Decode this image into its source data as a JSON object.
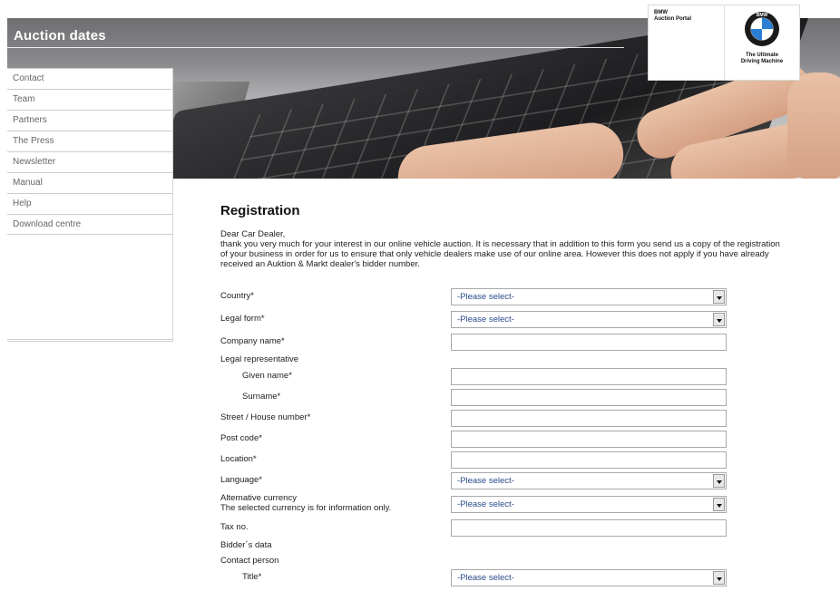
{
  "header": {
    "title": "Auction dates",
    "brand_portal_line1": "BMW",
    "brand_portal_line2": "Auction Portal",
    "slogan_line1": "The Ultimate",
    "slogan_line2": "Driving Machine",
    "logo_icon": "bmw-roundel-icon",
    "logo_letters": "BMW"
  },
  "sidebar": {
    "items": [
      {
        "label": "Contact"
      },
      {
        "label": "Team"
      },
      {
        "label": "Partners"
      },
      {
        "label": "The Press"
      },
      {
        "label": "Newsletter"
      },
      {
        "label": "Manual"
      },
      {
        "label": "Help"
      },
      {
        "label": "Download centre"
      }
    ]
  },
  "main": {
    "heading": "Registration",
    "greeting": "Dear Car Dealer,",
    "intro_line1": "thank you very much for your interest in our online vehicle auction. It is necessary that in addition to this form you send us a copy of the registration",
    "intro_line2": "of your business in order for us to ensure that only vehicle dealers make use of our online area. However this does not apply if you have already",
    "intro_line3": "received an Auktion & Markt dealer's bidder number."
  },
  "form": {
    "select_placeholder": "-Please select-",
    "country_label": "Country*",
    "legal_form_label": "Legal form*",
    "company_name_label": "Company name*",
    "legal_rep_label": "Legal representative",
    "given_name_label": "Given name*",
    "surname_label": "Surname*",
    "street_label": "Street / House number*",
    "post_code_label": "Post code*",
    "location_label": "Location*",
    "language_label": "Language*",
    "alt_currency_label": "Alternative currency",
    "alt_currency_note": "The selected currency is for information only.",
    "tax_no_label": "Tax no.",
    "bidders_data_label": "Bidder´s data",
    "contact_person_label": "Contact person",
    "title_label": "Title*"
  },
  "colors": {
    "header_text": "#ffffff",
    "select_text": "#2a4a8a",
    "nav_text": "#666666"
  }
}
